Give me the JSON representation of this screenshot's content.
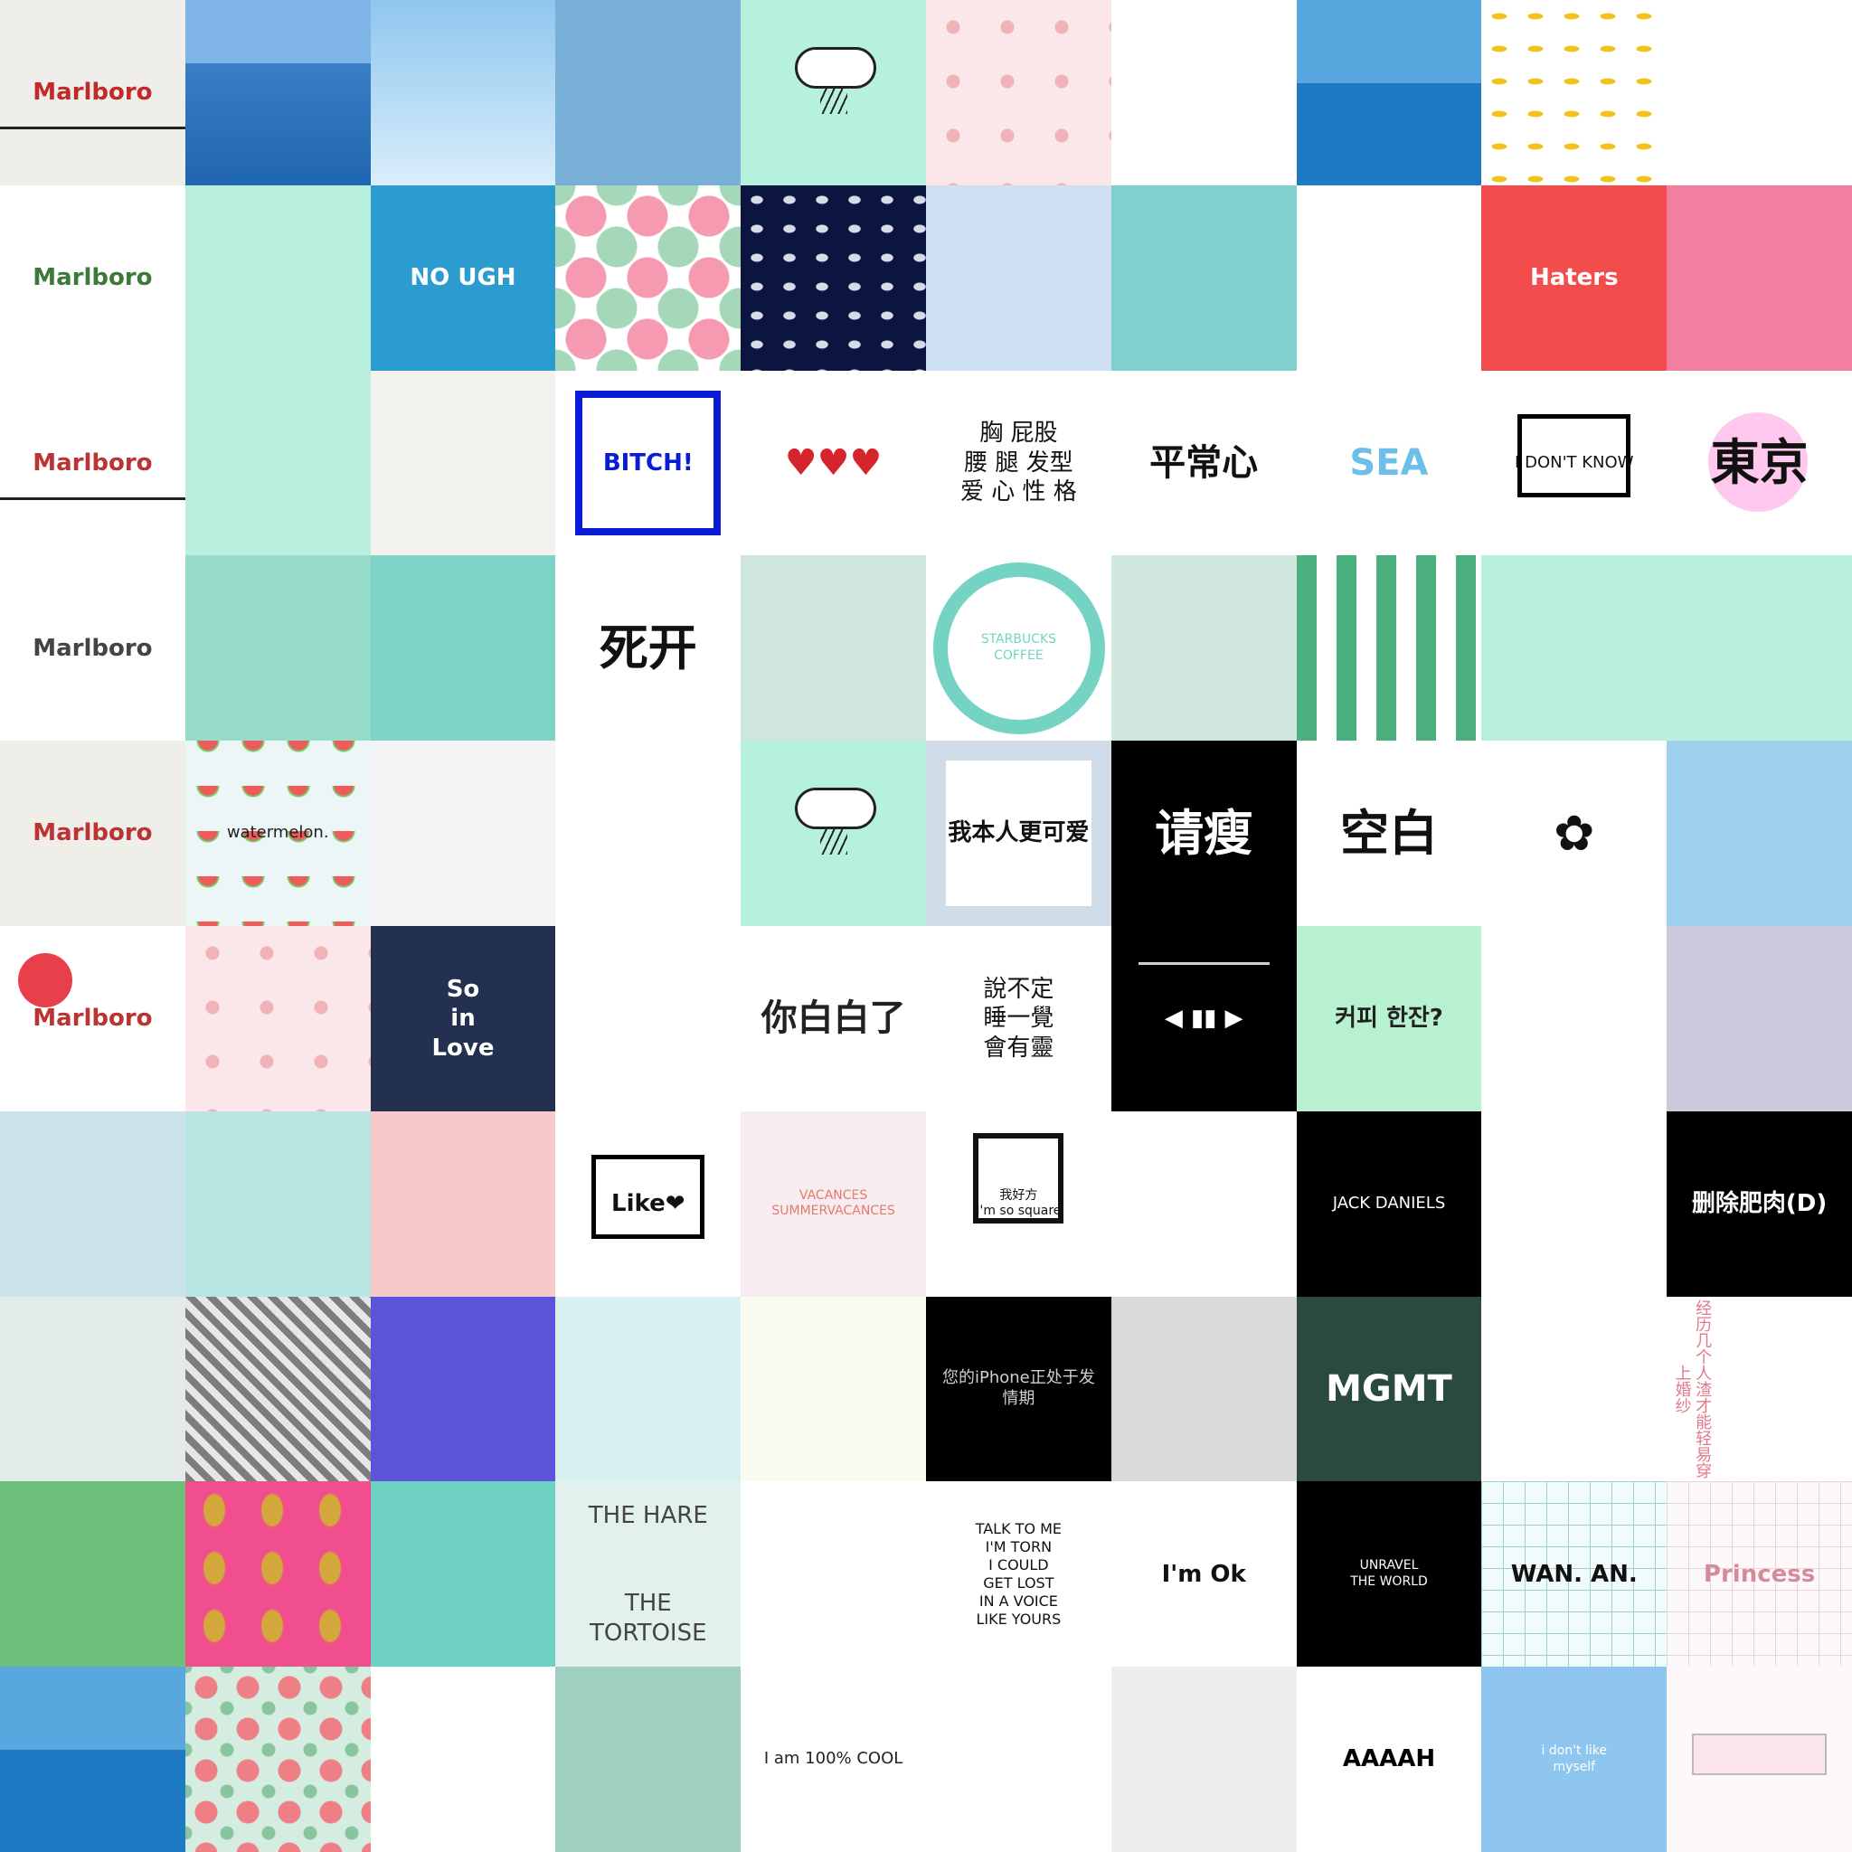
{
  "grid": {
    "rows": 10,
    "cols": 10
  },
  "tiles": [
    {
      "id": "r0c0",
      "name": "marlboro-packs",
      "bg": "#efeeea",
      "fg": "#c12a2a",
      "text": "Marlboro",
      "deco": "black-bar"
    },
    {
      "id": "r0c1",
      "name": "sea-horizon",
      "bg": "#7fb5e6",
      "fg": "#ffffff",
      "text": "",
      "deco": "sea-horizon"
    },
    {
      "id": "r0c2",
      "name": "blue-sky-clouds",
      "bg": "#2f79c0",
      "fg": "#ffffff",
      "text": "",
      "deco": "sky-grad"
    },
    {
      "id": "r0c3",
      "name": "bare-trees-blue",
      "bg": "#78b0d8",
      "fg": "#ffffff",
      "text": "",
      "deco": ""
    },
    {
      "id": "r0c4",
      "name": "rain-cloud",
      "bg": "#b6f1de",
      "fg": "#222222",
      "text": "",
      "deco": "cloud"
    },
    {
      "id": "r0c5",
      "name": "pink-pattern",
      "bg": "#fbe6ea",
      "fg": "#222222",
      "text": "",
      "deco": "dots-pink"
    },
    {
      "id": "r0c6",
      "name": "plain-white",
      "bg": "#ffffff",
      "fg": "#222222",
      "text": "",
      "deco": ""
    },
    {
      "id": "r0c7",
      "name": "ocean-water",
      "bg": "#1a7fc3",
      "fg": "#ffffff",
      "text": "",
      "deco": "ocean"
    },
    {
      "id": "r0c8",
      "name": "banana-pattern",
      "bg": "#ffffff",
      "fg": "#222222",
      "text": "",
      "deco": "banana"
    },
    {
      "id": "r0c9",
      "name": "sketch-girl",
      "bg": "#ffffff",
      "fg": "#222222",
      "text": "",
      "deco": ""
    },
    {
      "id": "r1c0",
      "name": "marlboro-green-pack",
      "bg": "#ffffff",
      "fg": "#3c7a3a",
      "text": "Marlboro",
      "deco": ""
    },
    {
      "id": "r1c1",
      "name": "girl-bunny-mint",
      "bg": "#b9f0dd",
      "fg": "#222222",
      "text": "",
      "deco": ""
    },
    {
      "id": "r1c2",
      "name": "monster-doodles",
      "bg": "#2b9bd0",
      "fg": "#ffffff",
      "text": "NO  UGH",
      "deco": ""
    },
    {
      "id": "r1c3",
      "name": "big-polka-dots",
      "bg": "#ffffff",
      "fg": "#222222",
      "text": "",
      "deco": "dots-big"
    },
    {
      "id": "r1c4",
      "name": "elephant-pattern",
      "bg": "#0b1540",
      "fg": "#ffffff",
      "text": "",
      "deco": "elephants"
    },
    {
      "id": "r1c5",
      "name": "pale-blue-pink",
      "bg": "#cfe0f4",
      "fg": "#222222",
      "text": "",
      "deco": ""
    },
    {
      "id": "r1c6",
      "name": "cats-clouds",
      "bg": "#7fd0cf",
      "fg": "#222222",
      "text": "",
      "deco": ""
    },
    {
      "id": "r1c7",
      "name": "flower-border",
      "bg": "#ffffff",
      "fg": "#222222",
      "text": "",
      "deco": ""
    },
    {
      "id": "r1c8",
      "name": "pug-tricycle",
      "bg": "#f24c4c",
      "fg": "#ffffff",
      "text": "Haters",
      "deco": ""
    },
    {
      "id": "r1c9",
      "name": "pink-mountains",
      "bg": "#f27ea0",
      "fg": "#ffffff",
      "text": "",
      "deco": ""
    },
    {
      "id": "r2c0",
      "name": "marlboro-box-hand",
      "bg": "#ffffff",
      "fg": "#b33",
      "text": "Marlboro",
      "deco": "black-bar"
    },
    {
      "id": "r2c1",
      "name": "three-faces",
      "bg": "#b9f0dd",
      "fg": "#222222",
      "text": "",
      "deco": ""
    },
    {
      "id": "r2c2",
      "name": "triangles",
      "bg": "#f4f2ec",
      "fg": "#222222",
      "text": "",
      "deco": ""
    },
    {
      "id": "r2c3",
      "name": "bitch-box",
      "bg": "#ffffff",
      "fg": "#0a1bd6",
      "text": "BITCH!",
      "deco": "ring-blue"
    },
    {
      "id": "r2c4",
      "name": "hearts",
      "bg": "#ffffff",
      "fg": "#d6242c",
      "text": "♥♥♥",
      "deco": ""
    },
    {
      "id": "r2c5",
      "name": "chinese-text-list",
      "bg": "#ffffff",
      "fg": "#111111",
      "text": "胸   屁股\n腰 腿 发型\n爱 心  性 格",
      "deco": ""
    },
    {
      "id": "r2c6",
      "name": "pingchangxin",
      "bg": "#ffffff",
      "fg": "#111111",
      "text": "平常心",
      "deco": ""
    },
    {
      "id": "r2c7",
      "name": "sea-brush",
      "bg": "#ffffff",
      "fg": "#6bbfe9",
      "text": "SEA",
      "deco": ""
    },
    {
      "id": "r2c8",
      "name": "i-dont-know",
      "bg": "#ffffff",
      "fg": "#111111",
      "text": "I DON'T KNOW",
      "deco": "bubble"
    },
    {
      "id": "r2c9",
      "name": "tokyo",
      "bg": "#ffffff",
      "fg": "#111111",
      "text": "東京",
      "deco": "pink-circle"
    },
    {
      "id": "r3c0",
      "name": "marlboro-hands",
      "bg": "#ffffff",
      "fg": "#444444",
      "text": "Marlboro",
      "deco": ""
    },
    {
      "id": "r3c1",
      "name": "mint-flowers",
      "bg": "#97dcc8",
      "fg": "#e8404a",
      "text": "",
      "deco": ""
    },
    {
      "id": "r3c2",
      "name": "bright-flowers",
      "bg": "#7fd4c8",
      "fg": "#222222",
      "text": "",
      "deco": ""
    },
    {
      "id": "r3c3",
      "name": "sikai",
      "bg": "#ffffff",
      "fg": "#111111",
      "text": "死开",
      "deco": ""
    },
    {
      "id": "r3c4",
      "name": "mint-table",
      "bg": "#cfe6dc",
      "fg": "#222222",
      "text": "",
      "deco": ""
    },
    {
      "id": "r3c5",
      "name": "starbucks-logo",
      "bg": "#ffffff",
      "fg": "#74d3c3",
      "text": "STARBUCKS\nCOFFEE",
      "deco": "round-logo"
    },
    {
      "id": "r3c6",
      "name": "mint-car",
      "bg": "#cfe7dd",
      "fg": "#222222",
      "text": "",
      "deco": ""
    },
    {
      "id": "r3c7",
      "name": "green-stripes",
      "bg": "#ffffff",
      "fg": "#222222",
      "text": "",
      "deco": "stripes"
    },
    {
      "id": "r3c8",
      "name": "girl-bunny-mint-2",
      "bg": "#b9f0dd",
      "fg": "#222222",
      "text": "",
      "deco": ""
    },
    {
      "id": "r3c9",
      "name": "ice-creams",
      "bg": "#b9f0dd",
      "fg": "#222222",
      "text": "",
      "deco": ""
    },
    {
      "id": "r4c0",
      "name": "marlboro-flowers",
      "bg": "#f0eee8",
      "fg": "#b33",
      "text": "Marlboro",
      "deco": ""
    },
    {
      "id": "r4c1",
      "name": "watermelon-pattern",
      "bg": "#ecf6f6",
      "fg": "#222222",
      "text": "watermelon.",
      "deco": "melon"
    },
    {
      "id": "r4c2",
      "name": "sketch-girl-deer",
      "bg": "#f4f4f4",
      "fg": "#222222",
      "text": "",
      "deco": ""
    },
    {
      "id": "r4c3",
      "name": "red-monkey",
      "bg": "#ffffff",
      "fg": "#e01d1d",
      "text": "",
      "deco": ""
    },
    {
      "id": "r4c4",
      "name": "rain-cloud-2",
      "bg": "#b6f1de",
      "fg": "#222222",
      "text": "",
      "deco": "cloud"
    },
    {
      "id": "r4c5",
      "name": "cute-card",
      "bg": "#cfdce8",
      "fg": "#111111",
      "text": "我本人更可爱",
      "deco": "card-white"
    },
    {
      "id": "r4c6",
      "name": "qingshou",
      "bg": "#000000",
      "fg": "#ffffff",
      "text": "请瘦",
      "deco": ""
    },
    {
      "id": "r4c7",
      "name": "kongbai-book",
      "bg": "#ffffff",
      "fg": "#111111",
      "text": "空白",
      "deco": ""
    },
    {
      "id": "r4c8",
      "name": "tiny-flower",
      "bg": "#ffffff",
      "fg": "#111111",
      "text": "✿",
      "deco": ""
    },
    {
      "id": "r4c9",
      "name": "sky-clouds",
      "bg": "#9fd1ef",
      "fg": "#ffffff",
      "text": "",
      "deco": ""
    },
    {
      "id": "r5c0",
      "name": "marlboro-red-flower",
      "bg": "#ffffff",
      "fg": "#b33",
      "text": "Marlboro",
      "deco": "flower-red"
    },
    {
      "id": "r5c1",
      "name": "pink-bunnies",
      "bg": "#fbe6ea",
      "fg": "#222222",
      "text": "",
      "deco": "dots-pink"
    },
    {
      "id": "r5c2",
      "name": "so-in-love",
      "bg": "#23304f",
      "fg": "#ffffff",
      "text": "So\nin\nLove",
      "deco": ""
    },
    {
      "id": "r5c3",
      "name": "mint-items",
      "bg": "#ffffff",
      "fg": "#222222",
      "text": "",
      "deco": ""
    },
    {
      "id": "r5c4",
      "name": "ni-dao-le",
      "bg": "#ffffff",
      "fg": "#222222",
      "text": "你白白了",
      "deco": ""
    },
    {
      "id": "r5c5",
      "name": "shuo-bu-ding",
      "bg": "#ffffff",
      "fg": "#111111",
      "text": "說不定\n睡一覺\n會有靈",
      "deco": ""
    },
    {
      "id": "r5c6",
      "name": "music-player",
      "bg": "#000000",
      "fg": "#ffffff",
      "text": "◀  ▮▮  ▶",
      "deco": "player-line"
    },
    {
      "id": "r5c7",
      "name": "coffee-korean",
      "bg": "#b8f1d0",
      "fg": "#222222",
      "text": "커피 한잔?",
      "deco": ""
    },
    {
      "id": "r5c8",
      "name": "hands-reach",
      "bg": "#ffffff",
      "fg": "#111111",
      "text": "",
      "deco": ""
    },
    {
      "id": "r5c9",
      "name": "bare-tree-lavender",
      "bg": "#c9c9db",
      "fg": "#222222",
      "text": "",
      "deco": ""
    },
    {
      "id": "r6c0",
      "name": "sketch-street",
      "bg": "#cde3ea",
      "fg": "#222222",
      "text": "",
      "deco": ""
    },
    {
      "id": "r6c1",
      "name": "cats-pattern",
      "bg": "#b9e6e3",
      "fg": "#222222",
      "text": "",
      "deco": ""
    },
    {
      "id": "r6c2",
      "name": "pineapple-flowers",
      "bg": "#f6c9c9",
      "fg": "#222222",
      "text": "",
      "deco": ""
    },
    {
      "id": "r6c3",
      "name": "like-bubble",
      "bg": "#ffffff",
      "fg": "#111111",
      "text": "Like❤",
      "deco": "bubble"
    },
    {
      "id": "r6c4",
      "name": "vacances",
      "bg": "#f7edf0",
      "fg": "#e67a6a",
      "text": "VACANCES\nSUMMERVACANCES",
      "deco": ""
    },
    {
      "id": "r6c5",
      "name": "square-cube",
      "bg": "#ffffff",
      "fg": "#111111",
      "text": "我好方\nI'm so square",
      "deco": "cube"
    },
    {
      "id": "r6c6",
      "name": "angry-corner",
      "bg": "#ffffff",
      "fg": "#111111",
      "text": "",
      "deco": ""
    },
    {
      "id": "r6c7",
      "name": "jack-daniels",
      "bg": "#000000",
      "fg": "#ffffff",
      "text": "JACK DANIELS",
      "deco": ""
    },
    {
      "id": "r6c8",
      "name": "black-cat",
      "bg": "#ffffff",
      "fg": "#111111",
      "text": "",
      "deco": ""
    },
    {
      "id": "r6c9",
      "name": "delete-menu",
      "bg": "#000000",
      "fg": "#ffffff",
      "text": "删除肥肉(D)",
      "deco": ""
    },
    {
      "id": "r7c0",
      "name": "sketch-sky",
      "bg": "#e3ece8",
      "fg": "#222222",
      "text": "",
      "deco": ""
    },
    {
      "id": "r7c1",
      "name": "chevron-flowers",
      "bg": "#e7e7e7",
      "fg": "#222222",
      "text": "",
      "deco": "chevron"
    },
    {
      "id": "r7c2",
      "name": "purple-pineapple",
      "bg": "#5b54d8",
      "fg": "#ffffff",
      "text": "",
      "deco": ""
    },
    {
      "id": "r7c3",
      "name": "mint-bag",
      "bg": "#d9f0f0",
      "fg": "#222222",
      "text": "",
      "deco": ""
    },
    {
      "id": "r7c4",
      "name": "blue-skirt-girl",
      "bg": "#fbfcf1",
      "fg": "#222222",
      "text": "",
      "deco": ""
    },
    {
      "id": "r7c5",
      "name": "iphone-black",
      "bg": "#000000",
      "fg": "#cfcfcf",
      "text": "您的iPhone正处于发情期",
      "deco": ""
    },
    {
      "id": "r7c6",
      "name": "funny-face",
      "bg": "#d9d9d9",
      "fg": "#111111",
      "text": "",
      "deco": ""
    },
    {
      "id": "r7c7",
      "name": "mgmt",
      "bg": "#294a3d",
      "fg": "#ffffff",
      "text": "MGMT",
      "deco": ""
    },
    {
      "id": "r7c8",
      "name": "sprout-korean",
      "bg": "#ffffff",
      "fg": "#111111",
      "text": "",
      "deco": ""
    },
    {
      "id": "r7c9",
      "name": "vertical-chinese",
      "bg": "#ffffff",
      "fg": "#e27a8a",
      "text": "经历几个人渣才能轻易穿上婚纱",
      "deco": ""
    },
    {
      "id": "r8c0",
      "name": "green-trees",
      "bg": "#6cc07a",
      "fg": "#222222",
      "text": "",
      "deco": ""
    },
    {
      "id": "r8c1",
      "name": "pineapple-pink",
      "bg": "#f14e8e",
      "fg": "#222222",
      "text": "",
      "deco": "cactus-fruit"
    },
    {
      "id": "r8c2",
      "name": "cats-row",
      "bg": "#6fd1c4",
      "fg": "#222222",
      "text": "",
      "deco": ""
    },
    {
      "id": "r8c3",
      "name": "hare-tortoise",
      "bg": "#e3f1ee",
      "fg": "#444444",
      "text": "THE HARE\n\n\nTHE TORTOISE",
      "deco": ""
    },
    {
      "id": "r8c4",
      "name": "tom-jerry",
      "bg": "#ffffff",
      "fg": "#444444",
      "text": "",
      "deco": ""
    },
    {
      "id": "r8c5",
      "name": "talk-to-me",
      "bg": "#ffffff",
      "fg": "#111111",
      "text": "TALK TO ME\nI'M TORN\nI COULD\nGET LOST\nIN A VOICE\nLIKE YOURS",
      "deco": ""
    },
    {
      "id": "r8c6",
      "name": "im-ok-cloud",
      "bg": "#ffffff",
      "fg": "#111111",
      "text": "I'm Ok",
      "deco": ""
    },
    {
      "id": "r8c7",
      "name": "unravel",
      "bg": "#000000",
      "fg": "#ffffff",
      "text": "UNRAVEL\nTHE WORLD",
      "deco": ""
    },
    {
      "id": "r8c8",
      "name": "wan-an-grid",
      "bg": "#f1fbfb",
      "fg": "#111111",
      "text": "WAN. AN.",
      "deco": "grid-lines"
    },
    {
      "id": "r8c9",
      "name": "princess-grid",
      "bg": "#fdf9fa",
      "fg": "#d78a9a",
      "text": "Princess",
      "deco": "grid-pink"
    },
    {
      "id": "r9c0",
      "name": "island-sea",
      "bg": "#1e7bc3",
      "fg": "#ffffff",
      "text": "",
      "deco": "ocean"
    },
    {
      "id": "r9c1",
      "name": "roses-pattern",
      "bg": "#d5ece1",
      "fg": "#222222",
      "text": "",
      "deco": "roses"
    },
    {
      "id": "r9c2",
      "name": "donuts-coffee",
      "bg": "#ffffff",
      "fg": "#222222",
      "text": "",
      "deco": ""
    },
    {
      "id": "r9c3",
      "name": "mint-window",
      "bg": "#9ecfc0",
      "fg": "#222222",
      "text": "",
      "deco": ""
    },
    {
      "id": "r9c4",
      "name": "100-cool",
      "bg": "#ffffff",
      "fg": "#222222",
      "text": "I am 100% COOL",
      "deco": ""
    },
    {
      "id": "r9c5",
      "name": "bunny-doodle",
      "bg": "#ffffff",
      "fg": "#111111",
      "text": "",
      "deco": ""
    },
    {
      "id": "r9c6",
      "name": "anime-sketch",
      "bg": "#eeeeee",
      "fg": "#111111",
      "text": "",
      "deco": ""
    },
    {
      "id": "r9c7",
      "name": "aaaah",
      "bg": "#ffffff",
      "fg": "#000000",
      "text": "AAAAH",
      "deco": ""
    },
    {
      "id": "r9c8",
      "name": "dont-like-myself",
      "bg": "#8ec6ef",
      "fg": "#ffffff",
      "text": "i don't like\nmyself",
      "deco": ""
    },
    {
      "id": "r9c9",
      "name": "pink-message",
      "bg": "#fdf9fa",
      "fg": "#222222",
      "text": "",
      "deco": "msg-box"
    }
  ]
}
